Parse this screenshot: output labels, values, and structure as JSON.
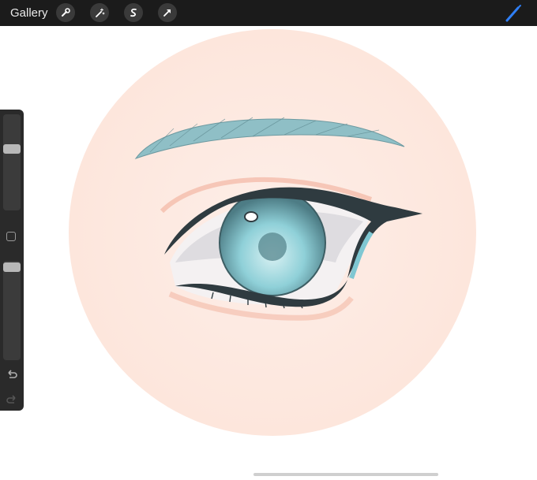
{
  "topbar": {
    "gallery_label": "Gallery",
    "tools": [
      {
        "icon": "wrench-icon"
      },
      {
        "icon": "magic-wand-icon"
      },
      {
        "icon": "selection-icon"
      },
      {
        "icon": "transform-arrow-icon"
      }
    ],
    "active_tool_icon": "brush-icon",
    "active_tool_color": "#2f7ff5"
  },
  "sidebar": {
    "brush_size_level": 0.27,
    "opacity_level": 0.05,
    "modifier_icon": "square-icon",
    "undo_icon": "undo-icon",
    "redo_icon": "redo-icon"
  },
  "colors": {
    "toolbar": "#1b1b1b",
    "skin": "#fde9e0",
    "iris": "#8fd0d8",
    "brow": "#8fbfc6",
    "line": "#2f3b40"
  }
}
